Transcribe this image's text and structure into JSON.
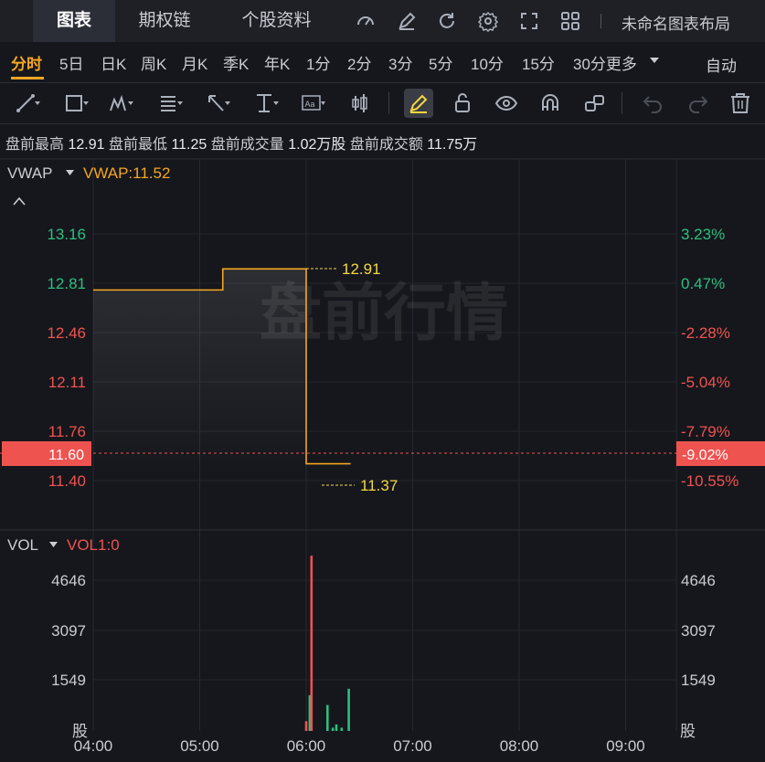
{
  "top_tabs": [
    {
      "label": "图表",
      "active": true
    },
    {
      "label": "期权链",
      "active": false
    },
    {
      "label": "个股资料",
      "active": false
    }
  ],
  "top_icons": [
    "gauge-icon",
    "edit-icon",
    "refresh-icon",
    "gear-icon",
    "fullscreen-icon",
    "grid-layout-icon"
  ],
  "layout_name": "未命名图表布局",
  "periods": [
    "分时",
    "5日",
    "日K",
    "周K",
    "月K",
    "季K",
    "年K",
    "1分",
    "2分",
    "3分",
    "5分",
    "10分",
    "15分",
    "30分更多"
  ],
  "active_period": "分时",
  "auto_label": "自动",
  "draw_tools": [
    "line-tool-icon",
    "rectangle-tool-icon",
    "pattern-tool-icon",
    "fib-tool-icon",
    "arrow-tool-icon",
    "measure-tool-icon",
    "text-tool-icon",
    "bars-tool-icon",
    "pencil-icon",
    "unlock-icon",
    "eye-icon",
    "magnet-icon",
    "link-icon",
    "undo-icon",
    "redo-icon",
    "trash-icon"
  ],
  "premarket": {
    "high_label": "盘前最高",
    "high": "12.91",
    "low_label": "盘前最低",
    "low": "11.25",
    "volume_label": "盘前成交量",
    "volume": "1.02万股",
    "amount_label": "盘前成交额",
    "amount": "11.75万"
  },
  "watermark": "盘前行情",
  "price_panel": {
    "indicator": "VWAP",
    "indicator_value": "VWAP:11.52",
    "left_ticks": [
      "13.16",
      "12.81",
      "12.46",
      "12.11",
      "11.76",
      "11.40"
    ],
    "right_ticks": [
      "3.23%",
      "0.47%",
      "-2.28%",
      "-5.04%",
      "-7.79%",
      "-10.55%"
    ],
    "current_price": "11.60",
    "current_change": "-9.02%",
    "high_marker": "12.91",
    "low_marker": "11.37"
  },
  "volume_panel": {
    "indicator": "VOL",
    "indicator_value": "VOL1:0",
    "ticks": [
      "4646",
      "3097",
      "1549"
    ],
    "unit": "股"
  },
  "time_axis": [
    "04:00",
    "05:00",
    "06:00",
    "07:00",
    "08:00",
    "09:00"
  ],
  "colors": {
    "up": "#2dbf7f",
    "down": "#ef5350",
    "accent": "#f5a623",
    "price_line": "#ffffff",
    "vwap_line": "#f5a623",
    "marker_text": "#f5d742"
  },
  "chart_data": {
    "type": "line",
    "x_range": [
      "04:00",
      "09:30"
    ],
    "ylim": [
      11.25,
      13.3
    ],
    "series": [
      {
        "name": "VWAP",
        "points": [
          [
            "04:00",
            12.76
          ],
          [
            "05:12",
            12.76
          ],
          [
            "05:13",
            12.91
          ],
          [
            "05:59",
            12.91
          ],
          [
            "06:00",
            11.52
          ],
          [
            "06:25",
            11.52
          ]
        ]
      }
    ],
    "volume": [
      {
        "time": "06:00",
        "value": 300,
        "color": "down"
      },
      {
        "time": "06:02",
        "value": 1100,
        "color": "up"
      },
      {
        "time": "06:03",
        "value": 5400,
        "color": "down"
      },
      {
        "time": "06:12",
        "value": 800,
        "color": "up"
      },
      {
        "time": "06:15",
        "value": 100,
        "color": "up"
      },
      {
        "time": "06:17",
        "value": 200,
        "color": "up"
      },
      {
        "time": "06:20",
        "value": 100,
        "color": "up"
      },
      {
        "time": "06:24",
        "value": 1300,
        "color": "up"
      }
    ]
  }
}
